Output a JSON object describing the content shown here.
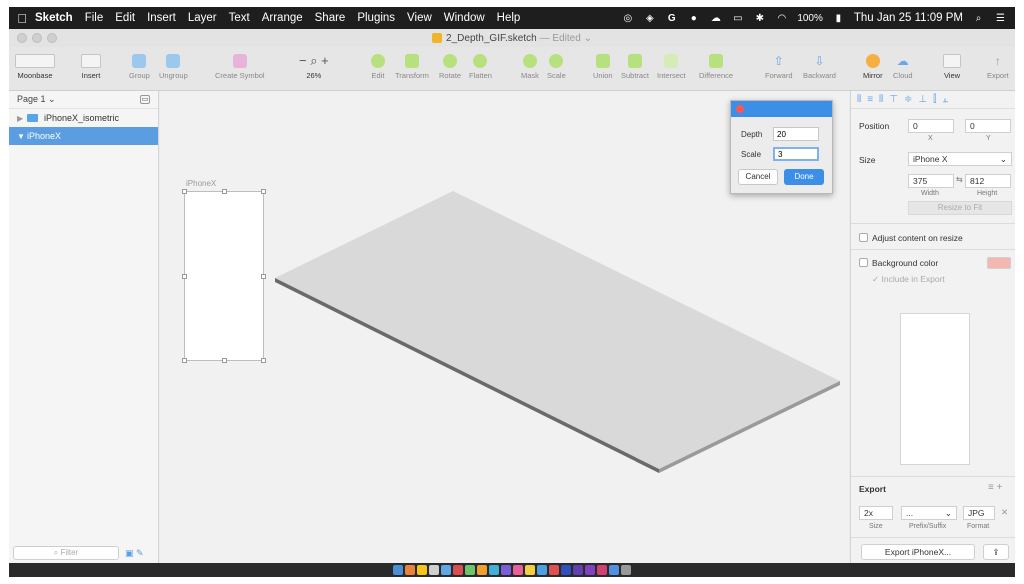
{
  "menubar": {
    "app_name": "Sketch",
    "menus": [
      "File",
      "Edit",
      "Insert",
      "Layer",
      "Text",
      "Arrange",
      "Share",
      "Plugins",
      "View",
      "Window",
      "Help"
    ],
    "battery": "100%",
    "clock": "Thu Jan 25  11:09 PM"
  },
  "window": {
    "title": "2_Depth_GIF.sketch",
    "edited": "— Edited ⌄"
  },
  "toolbar": {
    "moonbase": "Moonbase",
    "insert": "Insert",
    "group": "Group",
    "ungroup": "Ungroup",
    "create_symbol": "Create Symbol",
    "zoom": "26%",
    "edit": "Edit",
    "transform": "Transform",
    "rotate": "Rotate",
    "flatten": "Flatten",
    "mask": "Mask",
    "scale": "Scale",
    "union": "Union",
    "subtract": "Subtract",
    "intersect": "Intersect",
    "difference": "Difference",
    "forward": "Forward",
    "backward": "Backward",
    "mirror": "Mirror",
    "cloud": "Cloud",
    "view": "View",
    "export": "Export"
  },
  "layers": {
    "page": "Page 1 ⌄",
    "items": [
      {
        "name": "iPhoneX_isometric",
        "expanded": false,
        "selected": false
      },
      {
        "name": "iPhoneX",
        "expanded": true,
        "selected": true
      }
    ],
    "filter_placeholder": "Filter"
  },
  "canvas": {
    "artboard_label": "iPhoneX"
  },
  "dialog": {
    "depth_label": "Depth",
    "depth_value": "20",
    "scale_label": "Scale",
    "scale_value": "3",
    "cancel": "Cancel",
    "done": "Done"
  },
  "inspector": {
    "position_label": "Position",
    "pos_x": "0",
    "pos_y": "0",
    "x_label": "X",
    "y_label": "Y",
    "size_label": "Size",
    "size_preset": "iPhone X",
    "width": "375",
    "height": "812",
    "width_label": "Width",
    "height_label": "Height",
    "resize_to_fit": "Resize to Fit",
    "adjust_content": "Adjust content on resize",
    "background_color": "Background color",
    "include_in_export": "Include in Export",
    "export_label": "Export",
    "export_scale": "2x",
    "export_prefix": "...",
    "export_format": "JPG",
    "size_sub": "Size",
    "prefix_sub": "Prefix/Suffix",
    "format_sub": "Format",
    "export_button": "Export iPhoneX..."
  },
  "colors": {
    "accent": "#3d8ee6",
    "selection": "#5a9de0",
    "background_swatch": "#f4b8b0"
  }
}
